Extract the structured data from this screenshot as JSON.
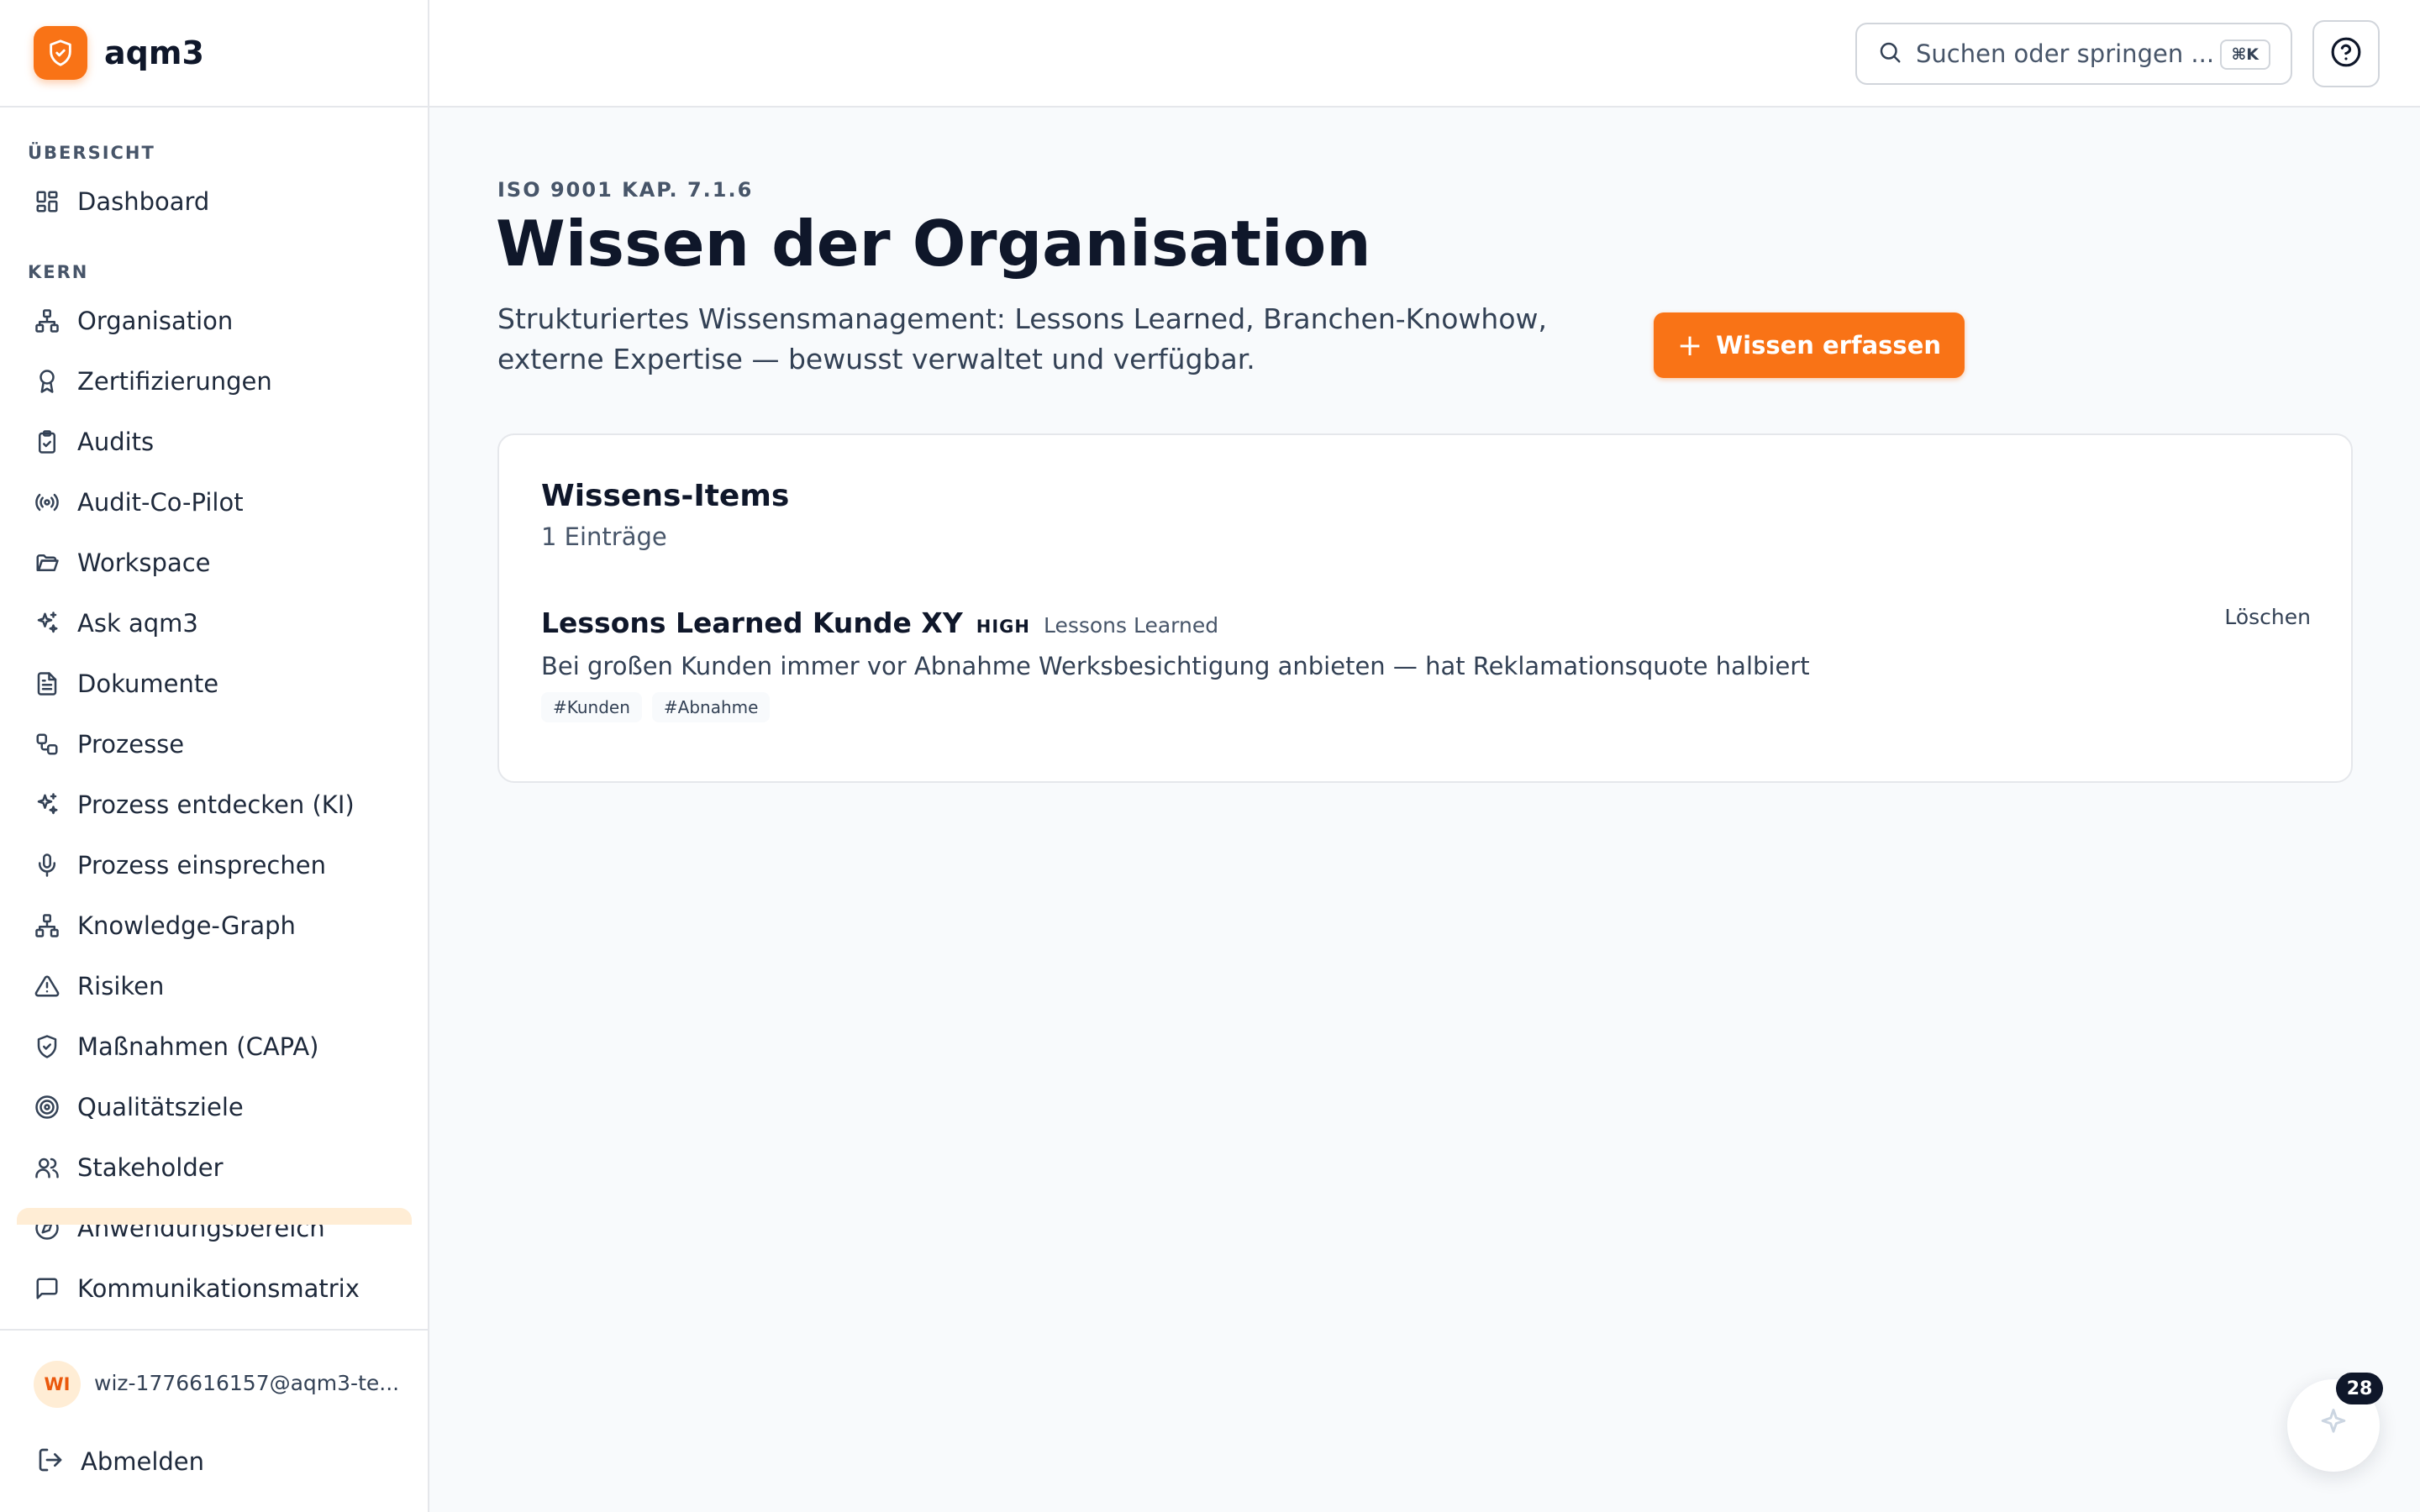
{
  "brand": {
    "name": "aqm3",
    "logo_icon": "shield-check-icon",
    "accent": "#f97316"
  },
  "sidebar": {
    "sections": [
      {
        "label": "ÜBERSICHT"
      },
      {
        "label": "KERN"
      }
    ],
    "items": [
      {
        "label": "Dashboard",
        "icon": "dashboard-icon"
      },
      {
        "label": "Organisation",
        "icon": "org-chart-icon"
      },
      {
        "label": "Zertifizierungen",
        "icon": "award-icon"
      },
      {
        "label": "Audits",
        "icon": "clipboard-check-icon"
      },
      {
        "label": "Audit-Co-Pilot",
        "icon": "radio-icon"
      },
      {
        "label": "Workspace",
        "icon": "folder-open-icon"
      },
      {
        "label": "Ask aqm3",
        "icon": "sparkles-icon"
      },
      {
        "label": "Dokumente",
        "icon": "file-text-icon"
      },
      {
        "label": "Prozesse",
        "icon": "workflow-icon"
      },
      {
        "label": "Prozess entdecken (KI)",
        "icon": "sparkles-icon"
      },
      {
        "label": "Prozess einsprechen",
        "icon": "mic-icon"
      },
      {
        "label": "Knowledge-Graph",
        "icon": "network-icon"
      },
      {
        "label": "Risiken",
        "icon": "alert-triangle-icon"
      },
      {
        "label": "Maßnahmen (CAPA)",
        "icon": "shield-check-icon"
      },
      {
        "label": "Qualitätsziele",
        "icon": "target-icon"
      },
      {
        "label": "Stakeholder",
        "icon": "users-icon"
      },
      {
        "label": "Anwendungsbereich",
        "icon": "compass-icon"
      },
      {
        "label": "Kommunikationsmatrix",
        "icon": "message-square-icon"
      }
    ]
  },
  "user": {
    "initials": "WI",
    "email": "wiz-1776616157@aqm3-te...",
    "logout_label": "Abmelden"
  },
  "topbar": {
    "search_placeholder": "Suchen oder springen ...",
    "shortcut": "⌘K",
    "help_icon": "help-circle-icon"
  },
  "page": {
    "eyebrow": "ISO 9001 KAP. 7.1.6",
    "title": "Wissen der Organisation",
    "description": "Strukturiertes Wissensmanagement: Lessons Learned, Branchen-Knowhow, externe Expertise — bewusst verwaltet und verfügbar.",
    "primary_button": "Wissen erfassen"
  },
  "card": {
    "title": "Wissens-Items",
    "count": "1 Einträge",
    "items": [
      {
        "title": "Lessons Learned Kunde XY",
        "priority": "HIGH",
        "category": "Lessons Learned",
        "description": "Bei großen Kunden immer vor Abnahme Werksbesichtigung anbieten — hat Reklamationsquote halbiert",
        "tags": [
          "#Kunden",
          "#Abnahme"
        ],
        "delete_label": "Löschen"
      }
    ]
  },
  "fab": {
    "badge": "28",
    "icon": "sparkles-icon"
  }
}
